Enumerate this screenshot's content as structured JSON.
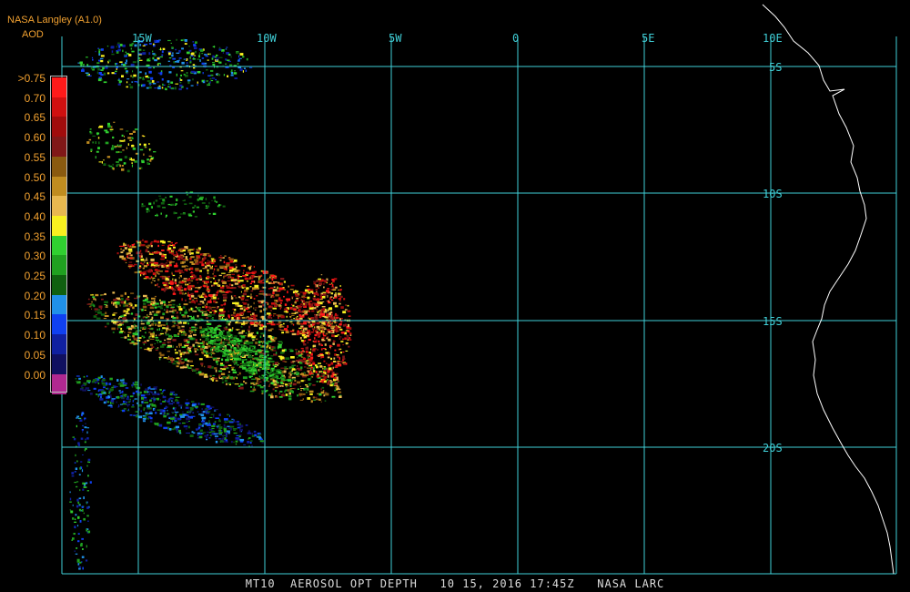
{
  "header": {
    "title": "NASA Langley (A1.0)",
    "variable": "AOD"
  },
  "legend": {
    "items": [
      {
        "label": ">0.75",
        "color": "#ff1a1a"
      },
      {
        "label": "0.70",
        "color": "#d01010"
      },
      {
        "label": "0.65",
        "color": "#a00c0c"
      },
      {
        "label": "0.60",
        "color": "#801818"
      },
      {
        "label": "0.55",
        "color": "#8a5a10"
      },
      {
        "label": "0.50",
        "color": "#c08c20"
      },
      {
        "label": "0.45",
        "color": "#e8b850"
      },
      {
        "label": "0.40",
        "color": "#f8f020"
      },
      {
        "label": "0.35",
        "color": "#30d030"
      },
      {
        "label": "0.30",
        "color": "#20a020"
      },
      {
        "label": "0.25",
        "color": "#106010"
      },
      {
        "label": "0.20",
        "color": "#2090e8"
      },
      {
        "label": "0.15",
        "color": "#1040f0"
      },
      {
        "label": "0.10",
        "color": "#1020a0"
      },
      {
        "label": "0.05",
        "color": "#101060"
      },
      {
        "label": "0.00",
        "color": "#b02890"
      }
    ]
  },
  "map": {
    "lon_labels": [
      "15W",
      "10W",
      "5W",
      "0",
      "5E",
      "10E"
    ],
    "lat_labels": [
      "5S",
      "10S",
      "15S",
      "20S"
    ],
    "grid_color": "#40d0d8",
    "coast_color": "#ffffff"
  },
  "footer": {
    "text": "MT10  AEROSOL OPT DEPTH   10 15, 2016 17:45Z   NASA LARC"
  }
}
